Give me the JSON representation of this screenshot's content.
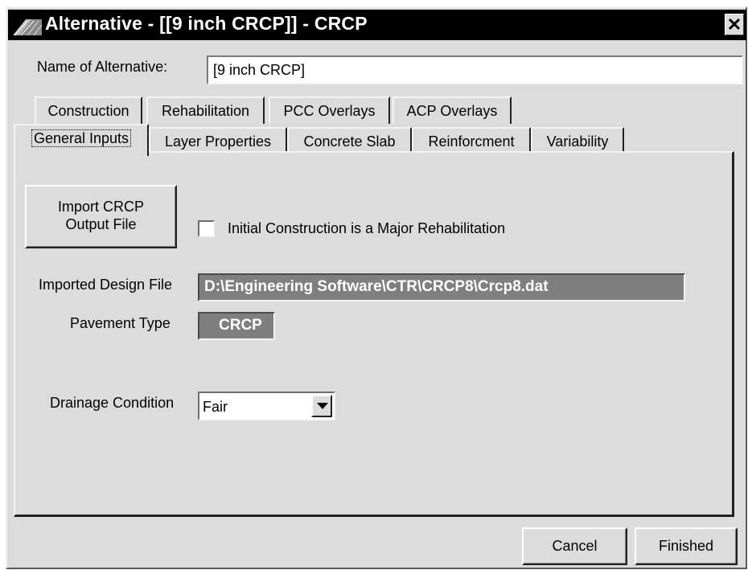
{
  "window": {
    "title": "Alternative - [[9 inch CRCP]] - CRCP",
    "close_glyph": "✕"
  },
  "name_field": {
    "label": "Name of Alternative:",
    "value": "[9 inch CRCP]"
  },
  "tabs_back_row": [
    {
      "label": "Construction"
    },
    {
      "label": "Rehabilitation"
    },
    {
      "label": "PCC Overlays"
    },
    {
      "label": "ACP Overlays"
    }
  ],
  "tabs_front_row": [
    {
      "label": "General Inputs",
      "active": true
    },
    {
      "label": "Layer Properties"
    },
    {
      "label": "Concrete Slab"
    },
    {
      "label": "Reinforcment"
    },
    {
      "label": "Variability"
    }
  ],
  "general_inputs": {
    "import_button": {
      "line1": "Import CRCP",
      "line2": "Output File"
    },
    "major_rehab_checkbox": {
      "label": "Initial Construction is a Major Rehabilitation",
      "checked": false
    },
    "imported_design_file": {
      "label": "Imported Design File",
      "value": "D:\\Engineering Software\\CTR\\CRCP8\\Crcp8.dat"
    },
    "pavement_type": {
      "label": "Pavement Type",
      "value": "CRCP"
    },
    "drainage_condition": {
      "label": "Drainage Condition",
      "value": "Fair"
    }
  },
  "footer": {
    "cancel": "Cancel",
    "finished": "Finished"
  },
  "colors": {
    "titlebar": "#000000",
    "face": "#dcdcdc",
    "readonly_field": "#7f7f7f"
  },
  "icons": [
    "app-icon",
    "close-icon",
    "dropdown-arrow-icon"
  ]
}
